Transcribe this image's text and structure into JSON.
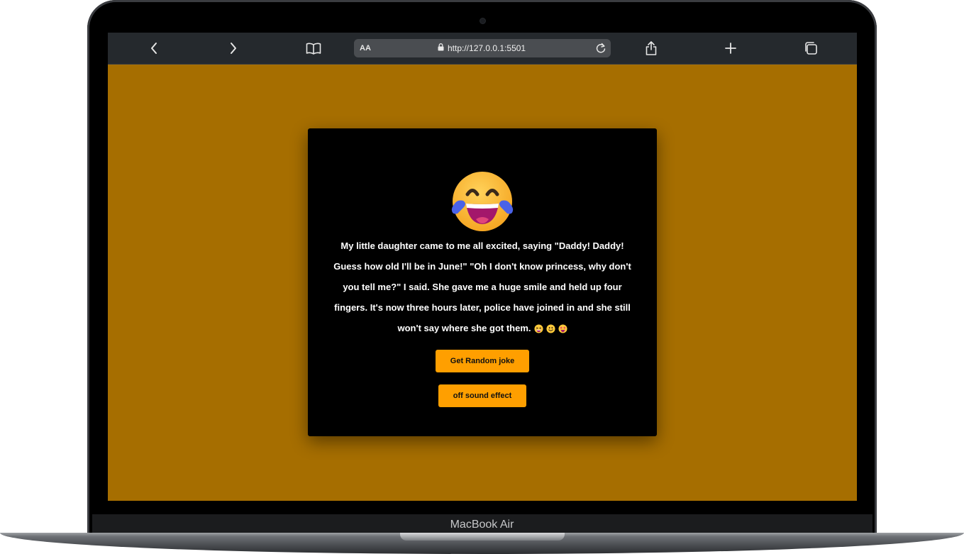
{
  "device": {
    "brand_label": "MacBook Air"
  },
  "browser": {
    "text_size_label": "AA",
    "url": "http://127.0.0.1:5501",
    "icons": [
      "chevron-left-icon",
      "chevron-right-icon",
      "book-icon",
      "lock-icon",
      "reload-icon",
      "share-icon",
      "plus-icon",
      "tabs-icon"
    ]
  },
  "app": {
    "background_color": "#a66e00",
    "card_color": "#000000",
    "main_emoji": "face-with-tears-of-joy",
    "joke_text": "My little daughter came to me all excited, saying \"Daddy! Daddy! Guess how old I'll be in June!\" \"Oh I don't know princess, why don't you tell me?\" I said. She gave me a huge smile and held up four fingers. It's now three hours later, police have joined in and she still won't say where she got them.",
    "trailing_emojis": [
      "grinning-squinting-face",
      "smiling-face",
      "star-struck"
    ],
    "joke_button_label": "Get Random joke",
    "sound_button_label": "off sound effect",
    "button_color": "#ff9f00"
  }
}
